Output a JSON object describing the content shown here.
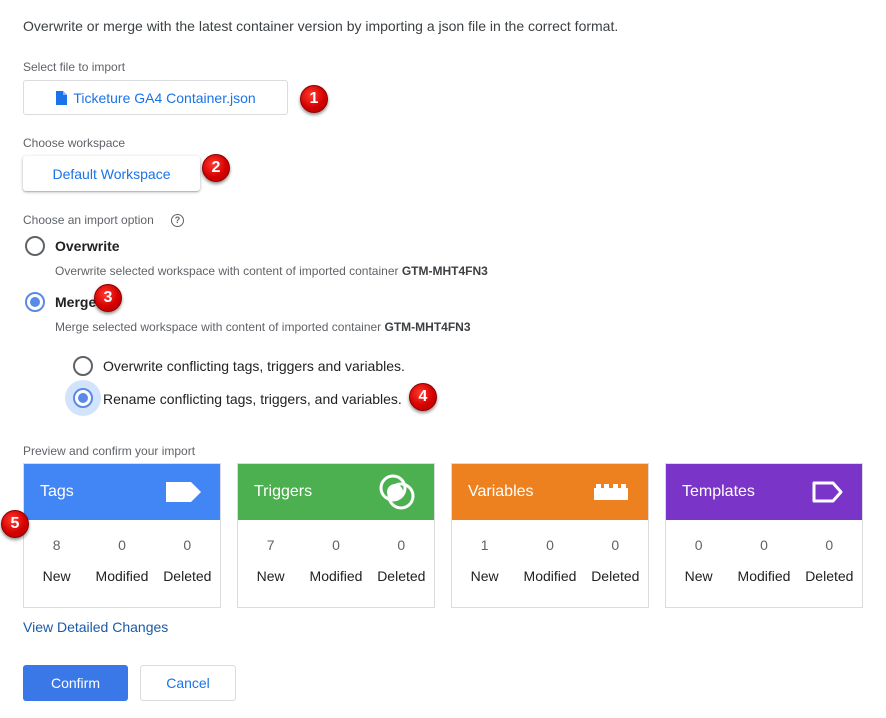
{
  "intro": "Overwrite or merge with the latest container version by importing a json file in the correct format.",
  "file": {
    "label": "Select file to import",
    "button": "Ticketure GA4 Container.json"
  },
  "workspace": {
    "label": "Choose workspace",
    "button": "Default Workspace"
  },
  "import_option": {
    "label": "Choose an import option",
    "help_icon": "?",
    "overwrite": {
      "title": "Overwrite",
      "desc": "Overwrite selected workspace with content of imported container",
      "container_id": "GTM-MHT4FN3",
      "selected": false
    },
    "merge": {
      "title": "Merge",
      "desc": "Merge selected workspace with content of imported container",
      "container_id": "GTM-MHT4FN3",
      "selected": true,
      "sub_options": [
        {
          "label": "Overwrite conflicting tags, triggers and variables.",
          "selected": false
        },
        {
          "label": "Rename conflicting tags, triggers, and variables.",
          "selected": true
        }
      ]
    }
  },
  "preview": {
    "label": "Preview and confirm your import",
    "cards": [
      {
        "title": "Tags",
        "color": "#4285f4",
        "icon": "tag-icon",
        "new": "8",
        "modified": "0",
        "deleted": "0"
      },
      {
        "title": "Triggers",
        "color": "#4caf50",
        "icon": "trigger-icon",
        "new": "7",
        "modified": "0",
        "deleted": "0"
      },
      {
        "title": "Variables",
        "color": "#ed8120",
        "icon": "variable-blocks-icon",
        "new": "1",
        "modified": "0",
        "deleted": "0"
      },
      {
        "title": "Templates",
        "color": "#7a35c8",
        "icon": "template-tag-outline-icon",
        "new": "0",
        "modified": "0",
        "deleted": "0"
      }
    ],
    "captions": {
      "new": "New",
      "modified": "Modified",
      "deleted": "Deleted"
    }
  },
  "link": "View Detailed Changes",
  "buttons": {
    "confirm": "Confirm",
    "cancel": "Cancel"
  },
  "badges": [
    "1",
    "2",
    "3",
    "4",
    "5"
  ],
  "accent": "#1a73e8"
}
